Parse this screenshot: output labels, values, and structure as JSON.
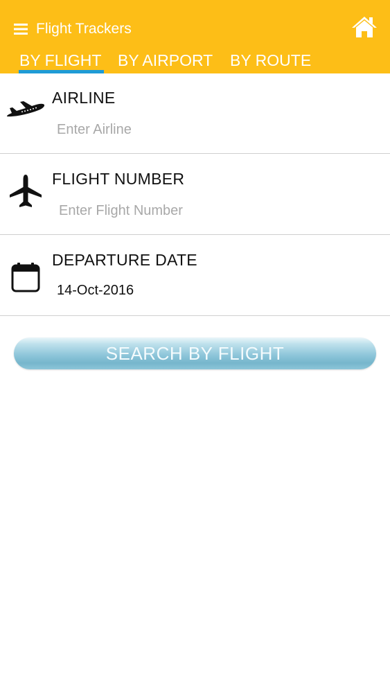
{
  "header": {
    "title": "Flight Trackers",
    "menu_icon": "hamburger-menu-icon",
    "home_icon": "home-icon",
    "background_color": "#FDBE17"
  },
  "tabs": [
    {
      "label": "BY FLIGHT",
      "active": true
    },
    {
      "label": "BY AIRPORT",
      "active": false
    },
    {
      "label": "BY ROUTE",
      "active": false
    }
  ],
  "tab_indicator_color": "#1E9BD6",
  "form": {
    "airline": {
      "label": "AIRLINE",
      "placeholder": "Enter Airline",
      "value": "",
      "icon": "airplane-takeoff-icon"
    },
    "flight_number": {
      "label": "FLIGHT NUMBER",
      "placeholder": "Enter Flight Number",
      "value": "",
      "icon": "airplane-icon"
    },
    "departure_date": {
      "label": "DEPARTURE DATE",
      "value": "14-Oct-2016",
      "icon": "calendar-icon"
    }
  },
  "search_button": {
    "label": "SEARCH BY FLIGHT"
  }
}
